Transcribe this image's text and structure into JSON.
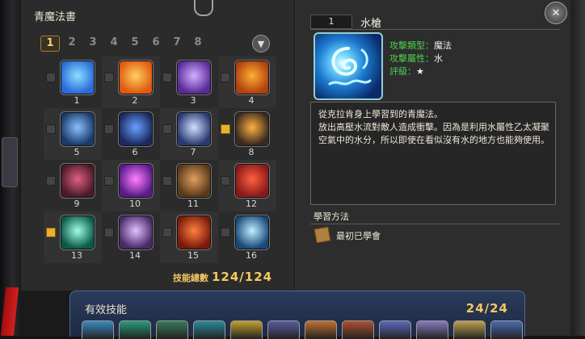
{
  "book": {
    "title": "青魔法書",
    "pages": [
      "1",
      "2",
      "3",
      "4",
      "5",
      "6",
      "7",
      "8"
    ],
    "active_page": "1",
    "filter_icon": "filter-icon"
  },
  "skills": [
    {
      "number": "1",
      "checked": false,
      "icon": "water-swirl",
      "colors": [
        "#2a6ad8",
        "#8ae0ff"
      ]
    },
    {
      "number": "2",
      "checked": false,
      "icon": "fire-burst",
      "colors": [
        "#e05a10",
        "#ffd060"
      ]
    },
    {
      "number": "3",
      "checked": false,
      "icon": "purple-claw",
      "colors": [
        "#5a2a9a",
        "#d0b0ff"
      ]
    },
    {
      "number": "4",
      "checked": false,
      "icon": "flame-dragon",
      "colors": [
        "#b04010",
        "#ffb030"
      ]
    },
    {
      "number": "5",
      "checked": false,
      "icon": "blue-spear",
      "colors": [
        "#1a3a6a",
        "#8ac0ff"
      ]
    },
    {
      "number": "6",
      "checked": false,
      "icon": "blue-orb",
      "colors": [
        "#1a2a60",
        "#6aa0ff"
      ]
    },
    {
      "number": "7",
      "checked": false,
      "icon": "spirit-figure",
      "colors": [
        "#2a3a70",
        "#d0e0ff"
      ]
    },
    {
      "number": "8",
      "checked": true,
      "icon": "fire-bomb",
      "colors": [
        "#3a2a20",
        "#ffb040"
      ]
    },
    {
      "number": "9",
      "checked": false,
      "icon": "dark-claw",
      "colors": [
        "#4a1a2a",
        "#e06080"
      ]
    },
    {
      "number": "10",
      "checked": false,
      "icon": "purple-eye",
      "colors": [
        "#5a1a8a",
        "#ff80ff"
      ]
    },
    {
      "number": "11",
      "checked": false,
      "icon": "dancing-creature",
      "colors": [
        "#5a3a1a",
        "#e0a060"
      ]
    },
    {
      "number": "12",
      "checked": false,
      "icon": "red-beast",
      "colors": [
        "#8a1a1a",
        "#ff6040"
      ]
    },
    {
      "number": "13",
      "checked": true,
      "icon": "green-light",
      "colors": [
        "#0a5a4a",
        "#a0ffe0"
      ]
    },
    {
      "number": "14",
      "checked": false,
      "icon": "storm-orb",
      "colors": [
        "#4a2a6a",
        "#e0c0ff"
      ]
    },
    {
      "number": "15",
      "checked": false,
      "icon": "red-blade",
      "colors": [
        "#7a1a0a",
        "#ff8040"
      ]
    },
    {
      "number": "16",
      "checked": false,
      "icon": "frost-figure",
      "colors": [
        "#1a4a7a",
        "#c0f0ff"
      ]
    }
  ],
  "total": {
    "label": "技能總數",
    "value": "124/124"
  },
  "active_skills": {
    "title": "有效技能",
    "count": "24/24",
    "colors": [
      "#3a8ac0",
      "#2a9a7a",
      "#3a7a5a",
      "#2a8a9a",
      "#c0a030",
      "#5a5aa0",
      "#c07030",
      "#b05030",
      "#5a6ac0",
      "#8a7ac0",
      "#c0a050",
      "#4a6ab0"
    ]
  },
  "detail": {
    "number": "1",
    "name": "水槍",
    "close_icon": "close-icon",
    "attributes": [
      {
        "key": "攻擊類型：",
        "value": "魔法"
      },
      {
        "key": "攻擊屬性：",
        "value": "水"
      },
      {
        "key": "評級：",
        "value": "★"
      }
    ],
    "description": [
      "從克拉肯身上學習到的青魔法。",
      "放出高壓水流對敵人造成衝擊。因為是利用水屬性乙太凝聚",
      "空氣中的水分，所以即使在看似沒有水的地方也能夠使用。"
    ],
    "learn_title": "學習方法",
    "learn_method": "最初已學會",
    "learn_icon": "scroll-icon"
  }
}
